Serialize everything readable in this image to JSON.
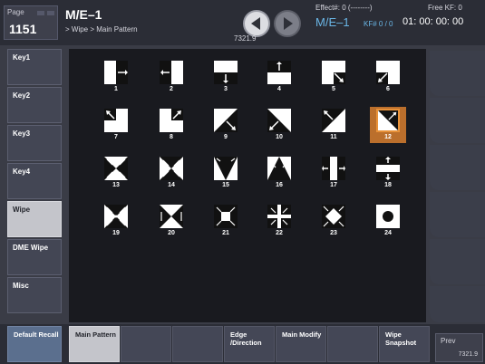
{
  "header": {
    "page_label": "Page",
    "page_number": "1151",
    "title": "M/E–1",
    "breadcrumb": "> Wipe > Main Pattern",
    "nav_value": "7321.9",
    "effect_label": "Effect#: 0 (--------)",
    "me_indicator": "M/E–1",
    "kf_count": "KF# 0 / 0",
    "free_kf": "Free KF: 0",
    "timecode": "01: 00: 00: 00"
  },
  "left_tabs": [
    {
      "label": "Key1",
      "active": false
    },
    {
      "label": "Key2",
      "active": false
    },
    {
      "label": "Key3",
      "active": false
    },
    {
      "label": "Key4",
      "active": false
    },
    {
      "label": "Wipe",
      "active": true
    },
    {
      "label": "DME Wipe",
      "active": false
    },
    {
      "label": "Misc",
      "active": false
    }
  ],
  "patterns": {
    "selected": "12",
    "items": [
      {
        "number": "1",
        "icon": "wipe-right-icon"
      },
      {
        "number": "2",
        "icon": "wipe-left-icon"
      },
      {
        "number": "3",
        "icon": "wipe-down-icon"
      },
      {
        "number": "4",
        "icon": "wipe-up-icon"
      },
      {
        "number": "5",
        "icon": "wipe-down-right-icon"
      },
      {
        "number": "6",
        "icon": "wipe-up-right-icon"
      },
      {
        "number": "7",
        "icon": "wipe-up-left-icon"
      },
      {
        "number": "8",
        "icon": "wipe-corner-up-right-icon"
      },
      {
        "number": "9",
        "icon": "diagonal-wipe-down-right-icon"
      },
      {
        "number": "10",
        "icon": "diagonal-wipe-down-left-icon"
      },
      {
        "number": "11",
        "icon": "diagonal-wipe-up-left-icon"
      },
      {
        "number": "12",
        "icon": "diagonal-wipe-up-right-icon"
      },
      {
        "number": "13",
        "icon": "bowtie-horizontal-out-icon"
      },
      {
        "number": "14",
        "icon": "bowtie-horizontal-in-icon"
      },
      {
        "number": "15",
        "icon": "triangle-down-icon"
      },
      {
        "number": "16",
        "icon": "triangle-up-icon"
      },
      {
        "number": "17",
        "icon": "barn-door-horizontal-icon"
      },
      {
        "number": "18",
        "icon": "barn-door-vertical-icon"
      },
      {
        "number": "19",
        "icon": "four-corner-in-icon"
      },
      {
        "number": "20",
        "icon": "bowtie-vertical-icon"
      },
      {
        "number": "21",
        "icon": "box-expand-icon"
      },
      {
        "number": "22",
        "icon": "cross-expand-icon"
      },
      {
        "number": "23",
        "icon": "diamond-expand-icon"
      },
      {
        "number": "24",
        "icon": "circle-icon"
      }
    ]
  },
  "bottom": {
    "default_recall": "Default Recall",
    "main_pattern": "Main Pattern",
    "edge_direction": "Edge /Direction",
    "main_modify": "Main Modify",
    "wipe_snapshot": "Wipe Snapshot",
    "prev_label": "Prev",
    "prev_value": "7321.9"
  },
  "colors": {
    "selection": "#bb6f2c",
    "active_tab": "#c4c5cb",
    "default_recall": "#5b6f8e",
    "me_indicator": "#6ab6e6"
  }
}
